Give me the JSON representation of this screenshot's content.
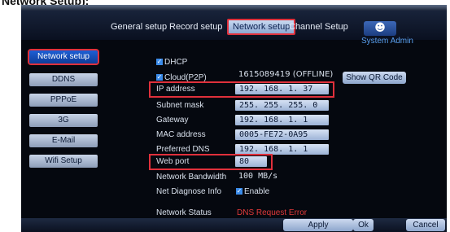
{
  "caption": "Network Setup);",
  "tabs": [
    {
      "label": "General setup"
    },
    {
      "label": "Record setup"
    },
    {
      "label": "Network setup"
    },
    {
      "label": "Channel Setup"
    }
  ],
  "user": {
    "icon": "user-icon",
    "name": "System Admin"
  },
  "sidebar": {
    "items": [
      {
        "label": "Network setup"
      },
      {
        "label": "DDNS"
      },
      {
        "label": "PPPoE"
      },
      {
        "label": "3G"
      },
      {
        "label": "E-Mail"
      },
      {
        "label": "Wifi Setup"
      }
    ]
  },
  "form": {
    "dhcp_label": "DHCP",
    "dhcp_checked": true,
    "cloud_label": "Cloud(P2P)",
    "cloud_checked": true,
    "cloud_value": "1615089419 (OFFLINE)",
    "show_qr_label": "Show QR Code",
    "ip_label": "IP address",
    "ip_value": "192. 168.   1.  37",
    "subnet_label": "Subnet mask",
    "subnet_value": "255. 255. 255.   0",
    "gateway_label": "Gateway",
    "gateway_value": "192. 168.   1.   1",
    "mac_label": "MAC address",
    "mac_value": "0005-FE72-0A95",
    "dns_label": "Preferred DNS",
    "dns_value": "192. 168.   1.   1",
    "webport_label": "Web port",
    "webport_value": "80",
    "bandwidth_label": "Network Bandwidth",
    "bandwidth_value": "100   MB/s",
    "diagnose_label": "Net Diagnose Info",
    "diagnose_enable_label": "Enable",
    "diagnose_checked": true,
    "status_label": "Network Status",
    "status_value": "DNS Request Error"
  },
  "buttons": {
    "apply": "Apply",
    "ok": "Ok",
    "cancel": "Cancel"
  },
  "colors": {
    "highlight_border": "#e0303b",
    "status_error": "#e23a3a",
    "accent_blue": "#1d5fd6"
  }
}
